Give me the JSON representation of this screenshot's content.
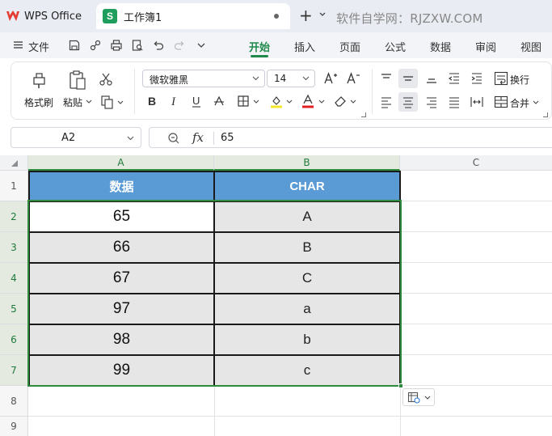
{
  "titlebar": {
    "app_name": "WPS Office",
    "doc_icon_letter": "S",
    "doc_title": "工作簿1",
    "new_tab": "+",
    "watermark": "软件自学网：RJZXW.COM"
  },
  "menubar": {
    "file": "文件",
    "tabs": [
      {
        "label": "开始",
        "active": true
      },
      {
        "label": "插入"
      },
      {
        "label": "页面"
      },
      {
        "label": "公式"
      },
      {
        "label": "数据"
      },
      {
        "label": "审阅"
      },
      {
        "label": "视图"
      }
    ]
  },
  "ribbon": {
    "format_painter": "格式刷",
    "paste": "粘贴",
    "font_name": "微软雅黑",
    "font_size": "14",
    "wrap_text": "换行",
    "merge": "合并"
  },
  "formula_bar": {
    "name_box": "A2",
    "fx": "fx",
    "value": "65"
  },
  "sheet": {
    "columns": [
      "A",
      "B",
      "C"
    ],
    "rows": [
      "1",
      "2",
      "3",
      "4",
      "5",
      "6",
      "7",
      "8",
      "9"
    ],
    "headers": [
      "数据",
      "CHAR"
    ],
    "data": [
      [
        "65",
        "A"
      ],
      [
        "66",
        "B"
      ],
      [
        "67",
        "C"
      ],
      [
        "97",
        "a"
      ],
      [
        "98",
        "b"
      ],
      [
        "99",
        "c"
      ]
    ]
  },
  "colors": {
    "accent": "#1f8a4c",
    "header_fill": "#5b9bd5",
    "cell_fill": "#e6e6e6",
    "selection": "#2e8b3e"
  }
}
